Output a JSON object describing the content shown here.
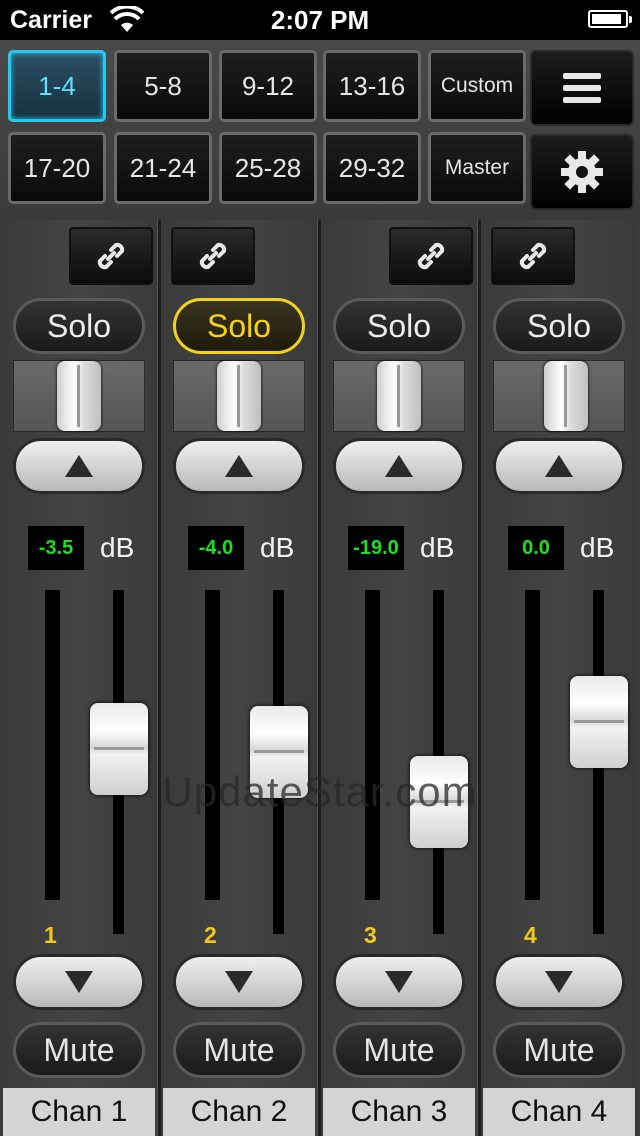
{
  "status_bar": {
    "carrier": "Carrier",
    "time": "2:07 PM",
    "battery_level": 0.9
  },
  "banks": {
    "row1": [
      "1-4",
      "5-8",
      "9-12",
      "13-16",
      "Custom"
    ],
    "row2": [
      "17-20",
      "21-24",
      "25-28",
      "29-32",
      "Master"
    ],
    "active": "1-4"
  },
  "tools": {
    "menu_icon": "menu-icon",
    "settings_icon": "gear-icon"
  },
  "channels": [
    {
      "name": "Chan 1",
      "number": "1",
      "solo_label": "Solo",
      "solo_on": false,
      "db": "-3.5",
      "db_unit": "dB",
      "mute_label": "Mute",
      "fader_level": 0.55,
      "pan": 0.5
    },
    {
      "name": "Chan 2",
      "number": "2",
      "solo_label": "Solo",
      "solo_on": true,
      "db": "-4.0",
      "db_unit": "dB",
      "mute_label": "Mute",
      "fader_level": 0.54,
      "pan": 0.5
    },
    {
      "name": "Chan 3",
      "number": "3",
      "solo_label": "Solo",
      "solo_on": false,
      "db": "-19.0",
      "db_unit": "dB",
      "mute_label": "Mute",
      "fader_level": 0.34,
      "pan": 0.5
    },
    {
      "name": "Chan 4",
      "number": "4",
      "solo_label": "Solo",
      "solo_on": false,
      "db": "0.0",
      "db_unit": "dB",
      "mute_label": "Mute",
      "fader_level": 0.66,
      "pan": 0.58
    }
  ],
  "watermark": "UpdateStar.com",
  "colors": {
    "active_bank": "#28c8ee",
    "solo_on": "#f3d21c",
    "db_text": "#1fe01f",
    "channel_number": "#f4c81a"
  }
}
